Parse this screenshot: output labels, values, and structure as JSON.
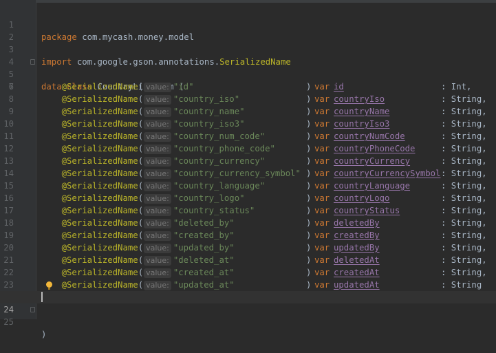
{
  "editor": {
    "line_numbers": [
      "1",
      "2",
      "3",
      "4",
      "5",
      "6",
      "7",
      "8",
      "9",
      "10",
      "11",
      "12",
      "13",
      "14",
      "15",
      "16",
      "17",
      "18",
      "19",
      "20",
      "21",
      "22",
      "23",
      "24",
      "25"
    ],
    "package_keyword": "package",
    "package_name": "com.mycash.money.model",
    "import_keyword": "import",
    "import_path": "com.google.gson.annotations.",
    "import_class": "SerializedName",
    "data_keyword": "data",
    "class_keyword": "class",
    "class_name": "CountryListItem",
    "open_paren": " (",
    "close_paren": ")",
    "annotation": "@SerializedName",
    "hint_label": "value:",
    "var_keyword": "var",
    "fields": [
      {
        "key": "\"id\"",
        "name": "id",
        "type": ": Int,"
      },
      {
        "key": "\"country_iso\"",
        "name": "countryIso",
        "type": ": String,"
      },
      {
        "key": "\"country_name\"",
        "name": "countryName",
        "type": ": String,"
      },
      {
        "key": "\"country_iso3\"",
        "name": "countryIso3",
        "type": ": String,"
      },
      {
        "key": "\"country_num_code\"",
        "name": "countryNumCode",
        "type": ": String,"
      },
      {
        "key": "\"country_phone_code\"",
        "name": "countryPhoneCode",
        "type": ": String,"
      },
      {
        "key": "\"country_currency\"",
        "name": "countryCurrency",
        "type": ": String,"
      },
      {
        "key": "\"country_currency_symbol\"",
        "name": "countryCurrencySymbol",
        "type": ": String,"
      },
      {
        "key": "\"country_language\"",
        "name": "countryLanguage",
        "type": ": String,"
      },
      {
        "key": "\"country_logo\"",
        "name": "countryLogo",
        "type": ": String,"
      },
      {
        "key": "\"country_status\"",
        "name": "countryStatus",
        "type": ": String,"
      },
      {
        "key": "\"deleted_by\"",
        "name": "deletedBy",
        "type": ": String,"
      },
      {
        "key": "\"created_by\"",
        "name": "createdBy",
        "type": ": String,"
      },
      {
        "key": "\"updated_by\"",
        "name": "updatedBy",
        "type": ": String,"
      },
      {
        "key": "\"deleted_at\"",
        "name": "deletedAt",
        "type": ": String,"
      },
      {
        "key": "\"created_at\"",
        "name": "createdAt",
        "type": ": String,"
      },
      {
        "key": "\"updated_at\"",
        "name": "updatedAt",
        "type": ": String"
      }
    ],
    "current_line": "24",
    "colors": {
      "background": "#2b2b2b",
      "keyword": "#cc7832",
      "annotation": "#bbb529",
      "string": "#6a8759",
      "property": "#9876aa",
      "text": "#a9b7c6"
    },
    "icons": [
      "fold-marker-icon",
      "intention-bulb-icon"
    ]
  }
}
